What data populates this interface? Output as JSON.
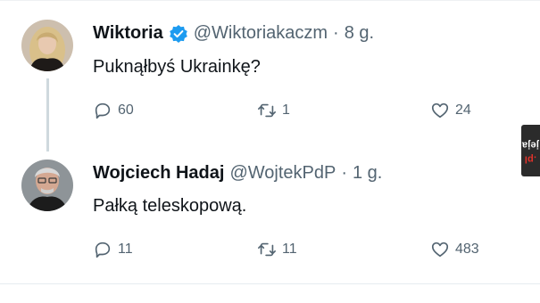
{
  "tweets": [
    {
      "display_name": "Wiktoria",
      "verified": true,
      "handle": "@Wiktoriakaczm",
      "separator": "·",
      "time": "8 g.",
      "text": "Puknąłbyś Ukrainkę?",
      "reply_count": "60",
      "retweet_count": "1",
      "like_count": "24",
      "avatar_icon": "avatar-photo-woman-blonde"
    },
    {
      "display_name": "Wojciech Hadaj",
      "verified": false,
      "handle": "@WojtekPdP",
      "separator": "·",
      "time": "1 g.",
      "text": "Pałką teleskopową.",
      "reply_count": "11",
      "retweet_count": "11",
      "like_count": "483",
      "avatar_icon": "avatar-photo-man-grey-hair"
    }
  ],
  "icons": {
    "reply": "reply-icon",
    "retweet": "retweet-icon",
    "like": "heart-icon",
    "verified": "verified-badge-icon"
  },
  "watermark": {
    "part1": "jeja",
    "part2": ".pl"
  },
  "colors": {
    "text_primary": "#0f1419",
    "text_secondary": "#536471",
    "verified_blue": "#1d9bf0",
    "thread_line": "#cfd9de",
    "watermark_bg": "#2b2b2b",
    "watermark_accent": "#e2322b"
  }
}
